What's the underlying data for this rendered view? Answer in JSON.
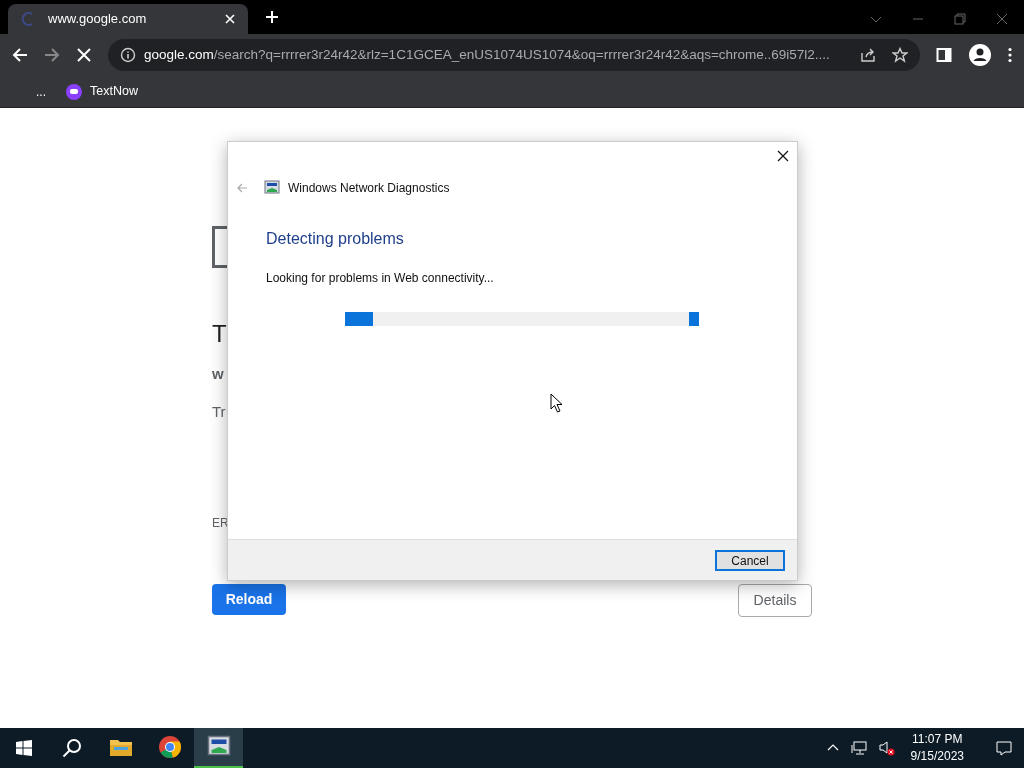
{
  "browser": {
    "tab_title": "www.google.com",
    "address_domain": "google.com",
    "address_path": "/search?q=rrrrer3r24r42&rlz=1C1GCEA_enUS1074US1074&oq=rrrrer3r24r42&aqs=chrome..69i57l2....",
    "bookmarks_overflow": "...",
    "bookmarks": [
      "TextNow"
    ]
  },
  "page": {
    "heading": "T",
    "site": "w",
    "hint": "Tr",
    "error_code": "ER",
    "reload_button": "Reload",
    "details_button": "Details"
  },
  "dialog": {
    "title": "Windows Network Diagnostics",
    "heading": "Detecting problems",
    "status": "Looking for problems in Web connectivity...",
    "progress": {
      "level": 0.08
    },
    "cancel_button": "Cancel"
  },
  "taskbar": {
    "apps": [
      {
        "kind": "files",
        "selected": false
      },
      {
        "kind": "chrome",
        "selected": false
      },
      {
        "kind": "diagnostics",
        "selected": true
      }
    ],
    "time": "11:07 PM",
    "date": "9/15/2023"
  }
}
